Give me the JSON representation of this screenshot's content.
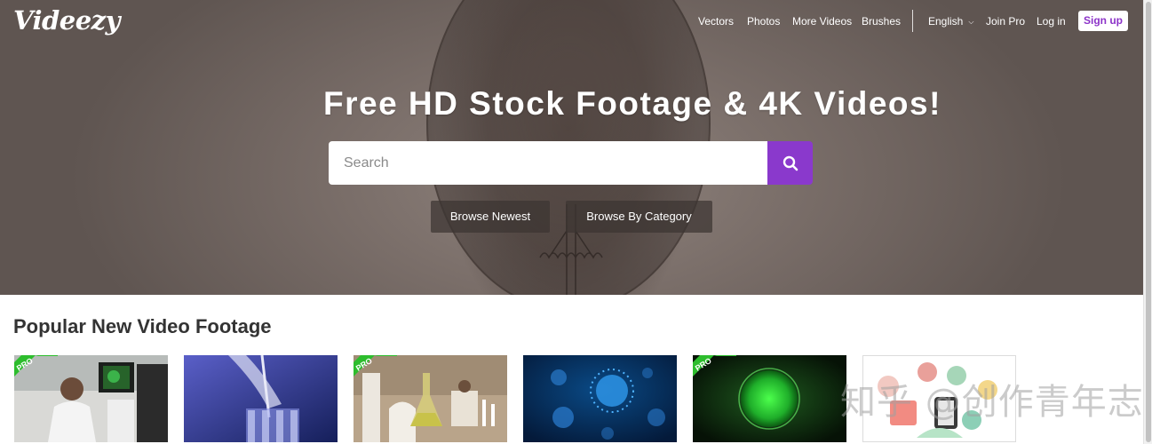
{
  "header": {
    "logo": "Videezy",
    "nav": [
      "Vectors",
      "Photos",
      "More Videos",
      "Brushes"
    ],
    "language": "English",
    "join_pro": "Join Pro",
    "login": "Log in",
    "signup": "Sign up"
  },
  "hero": {
    "title": "Free HD Stock Footage & 4K Videos!",
    "search_placeholder": "Search",
    "browse_newest": "Browse Newest",
    "browse_category": "Browse By Category"
  },
  "section": {
    "title": "Popular New Video Footage"
  },
  "thumbnails": [
    {
      "subject": "scientist at microscope",
      "pro": true
    },
    {
      "subject": "pipette into glassware",
      "pro": false
    },
    {
      "subject": "laboratory with flask",
      "pro": true
    },
    {
      "subject": "blue virus particles",
      "pro": false
    },
    {
      "subject": "green cell",
      "pro": true
    },
    {
      "subject": "online shopping illustration",
      "pro": false
    }
  ],
  "badge_label": "PRO",
  "watermark": "知乎 @创作青年志",
  "colors": {
    "accent_purple": "#8a39cc",
    "pro_green": "#2dbd2d",
    "section_text": "#333333"
  }
}
